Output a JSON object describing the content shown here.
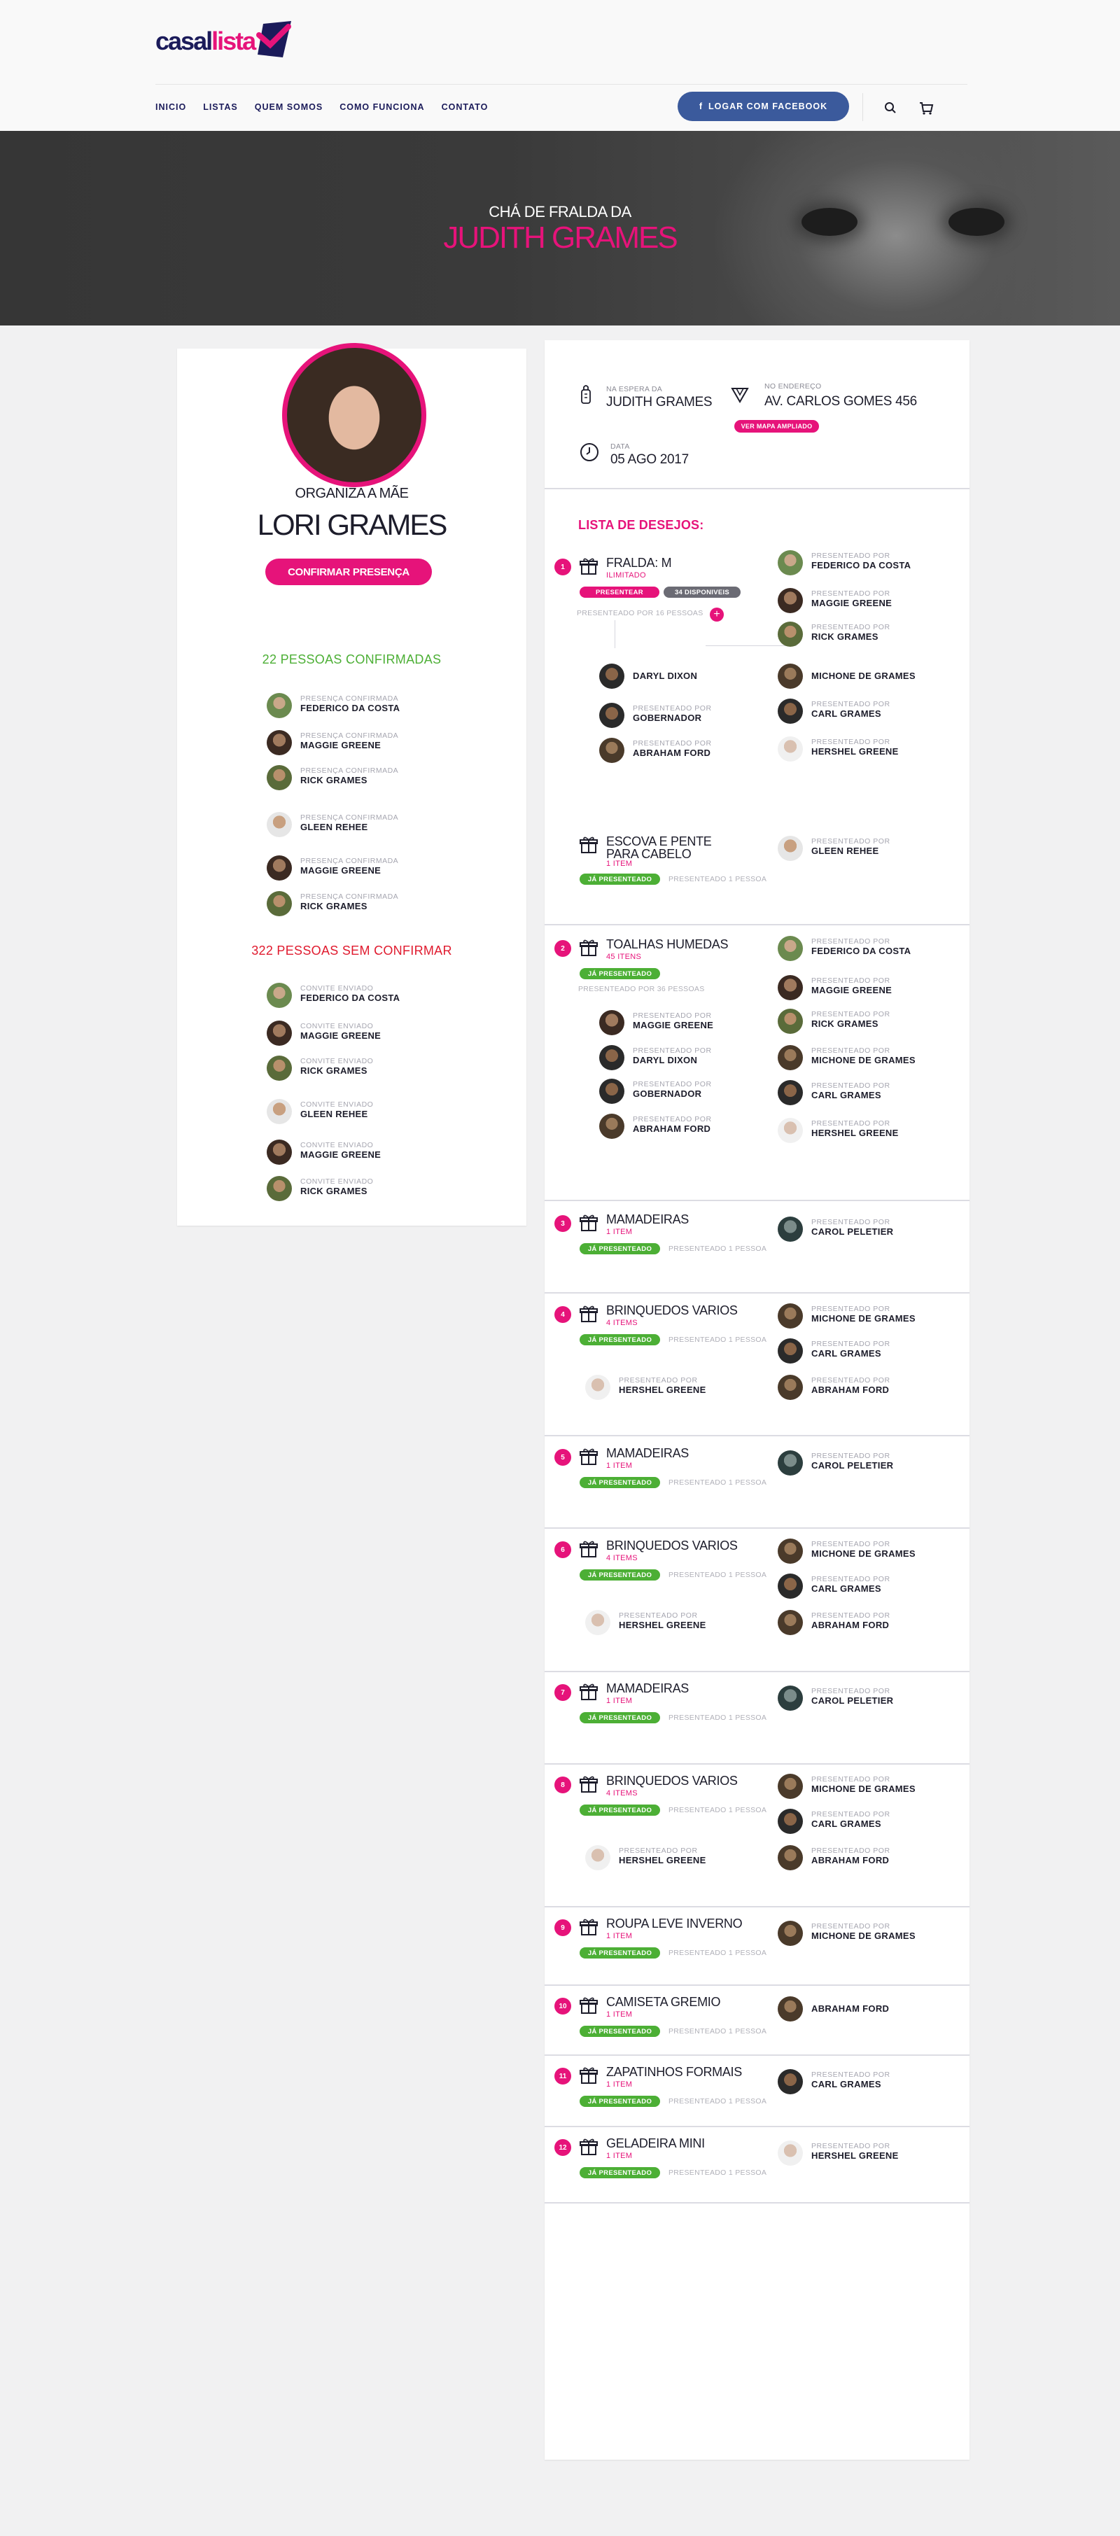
{
  "brand": {
    "logo_part1": "casal",
    "logo_part2": "lista"
  },
  "nav": [
    "INICIO",
    "LISTAS",
    "QUEM SOMOS",
    "COMO FUNCIONA",
    "CONTATO"
  ],
  "facebook_label": "LOGAR COM FACEBOOK",
  "hero": {
    "subtitle": "CHÁ DE FRALDA DA",
    "title": "JUDITH GRAMES"
  },
  "organizer": {
    "label": "ORGANIZA A MÃE",
    "name": "LORI GRAMES",
    "confirm_label": "CONFIRMAR PRESENÇA"
  },
  "confirmed": {
    "title": "22 PESSOAS CONFIRMADAS",
    "status": "PRESENÇA CONFIRMADA",
    "people": [
      "FEDERICO DA COSTA",
      "MAGGIE GREENE",
      "RICK GRAMES",
      "GLEEN REHEE",
      "MAGGIE GREENE",
      "RICK GRAMES"
    ]
  },
  "pending": {
    "title": "322 PESSOAS SEM CONFIRMAR",
    "status": "CONVITE ENVIADO",
    "people": [
      "FEDERICO DA COSTA",
      "MAGGIE GREENE",
      "RICK GRAMES",
      "GLEEN REHEE",
      "MAGGIE GREENE",
      "RICK GRAMES"
    ]
  },
  "info": {
    "waiting_label": "NA ESPERA DA",
    "waiting_value": "JUDITH GRAMES",
    "address_label": "NO ENDEREÇO",
    "address_value": "AV. CARLOS GOMES 456",
    "map_label": "VER MAPA AMPLIADO",
    "date_label": "DATA",
    "date_value": "05 AGO 2017"
  },
  "wishlist_title": "LISTA DE DESEJOS:",
  "labels": {
    "given_by": "PRESENTEADO POR",
    "given": "JÁ PRESENTEADO",
    "give": "PRESENTEAR"
  },
  "items": [
    {
      "n": "1",
      "title": "FRALDA: M",
      "sub": "ILIMITADO",
      "available": "34 DISPONIVEIS",
      "given_by": "PRESENTEADO POR 16 PESSOAS",
      "right": [
        "FEDERICO DA COSTA",
        "MAGGIE GREENE",
        "RICK GRAMES",
        "MICHONE DE GRAMES",
        "CARL GRAMES",
        "HERSHEL GREENE"
      ],
      "left": [
        "DARYL DIXON",
        "GOBERNADOR",
        "ABRAHAM FORD"
      ],
      "sub_item": {
        "title1": "ESCOVA E PENTE",
        "title2": "PARA CABELO",
        "sub": "1 ITEM",
        "given_by": "PRESENTEADO 1 PESSOA",
        "person": "GLEEN REHEE"
      }
    },
    {
      "n": "2",
      "title": "TOALHAS HUMEDAS",
      "sub": "45 ITENS",
      "given_by": "PRESENTEADO POR 36 PESSOAS",
      "right": [
        "FEDERICO DA COSTA",
        "MAGGIE GREENE",
        "RICK GRAMES",
        "MICHONE DE GRAMES",
        "CARL GRAMES",
        "HERSHEL GREENE"
      ],
      "left": [
        "MAGGIE GREENE",
        "DARYL DIXON",
        "GOBERNADOR",
        "ABRAHAM FORD"
      ]
    },
    {
      "n": "3",
      "title": "MAMADEIRAS",
      "sub": "1 ITEM",
      "given_by": "PRESENTEADO 1 PESSOA",
      "right": [
        "CAROL PELETIER"
      ]
    },
    {
      "n": "4",
      "title": "BRINQUEDOS VARIOS",
      "sub": "4 ITEMS",
      "given_by": "PRESENTEADO 1 PESSOA",
      "right": [
        "MICHONE DE GRAMES",
        "CARL GRAMES",
        "ABRAHAM FORD"
      ],
      "left": [
        "HERSHEL GREENE"
      ]
    },
    {
      "n": "5",
      "title": "MAMADEIRAS",
      "sub": "1 ITEM",
      "given_by": "PRESENTEADO 1 PESSOA",
      "right": [
        "CAROL PELETIER"
      ]
    },
    {
      "n": "6",
      "title": "BRINQUEDOS VARIOS",
      "sub": "4 ITEMS",
      "given_by": "PRESENTEADO 1 PESSOA",
      "right": [
        "MICHONE DE GRAMES",
        "CARL GRAMES",
        "ABRAHAM FORD"
      ],
      "left": [
        "HERSHEL GREENE"
      ]
    },
    {
      "n": "7",
      "title": "MAMADEIRAS",
      "sub": "1 ITEM",
      "given_by": "PRESENTEADO 1 PESSOA",
      "right": [
        "CAROL PELETIER"
      ]
    },
    {
      "n": "8",
      "title": "BRINQUEDOS VARIOS",
      "sub": "4 ITEMS",
      "given_by": "PRESENTEADO 1 PESSOA",
      "right": [
        "MICHONE DE GRAMES",
        "CARL GRAMES",
        "ABRAHAM FORD"
      ],
      "left": [
        "HERSHEL GREENE"
      ]
    },
    {
      "n": "9",
      "title": "ROUPA LEVE INVERNO",
      "sub": "1 ITEM",
      "given_by": "PRESENTEADO 1 PESSOA",
      "right": [
        "MICHONE DE GRAMES"
      ]
    },
    {
      "n": "10",
      "title": "CAMISETA GREMIO",
      "sub": "1 ITEM",
      "given_by": "PRESENTEADO 1 PESSOA",
      "right": [
        "ABRAHAM FORD"
      ]
    },
    {
      "n": "11",
      "title": "ZAPATINHOS FORMAIS",
      "sub": "1 ITEM",
      "given_by": "PRESENTEADO 1 PESSOA",
      "right": [
        "CARL GRAMES"
      ]
    },
    {
      "n": "12",
      "title": "GELADEIRA MINI",
      "sub": "1 ITEM",
      "given_by": "PRESENTEADO 1 PESSOA",
      "right": [
        "HERSHEL GREENE"
      ]
    }
  ],
  "colors": {
    "accent": "#e6137a",
    "brand": "#1b1b5a",
    "facebook": "#3b5a9c",
    "success": "#4caf35",
    "danger": "#e01a2e"
  }
}
